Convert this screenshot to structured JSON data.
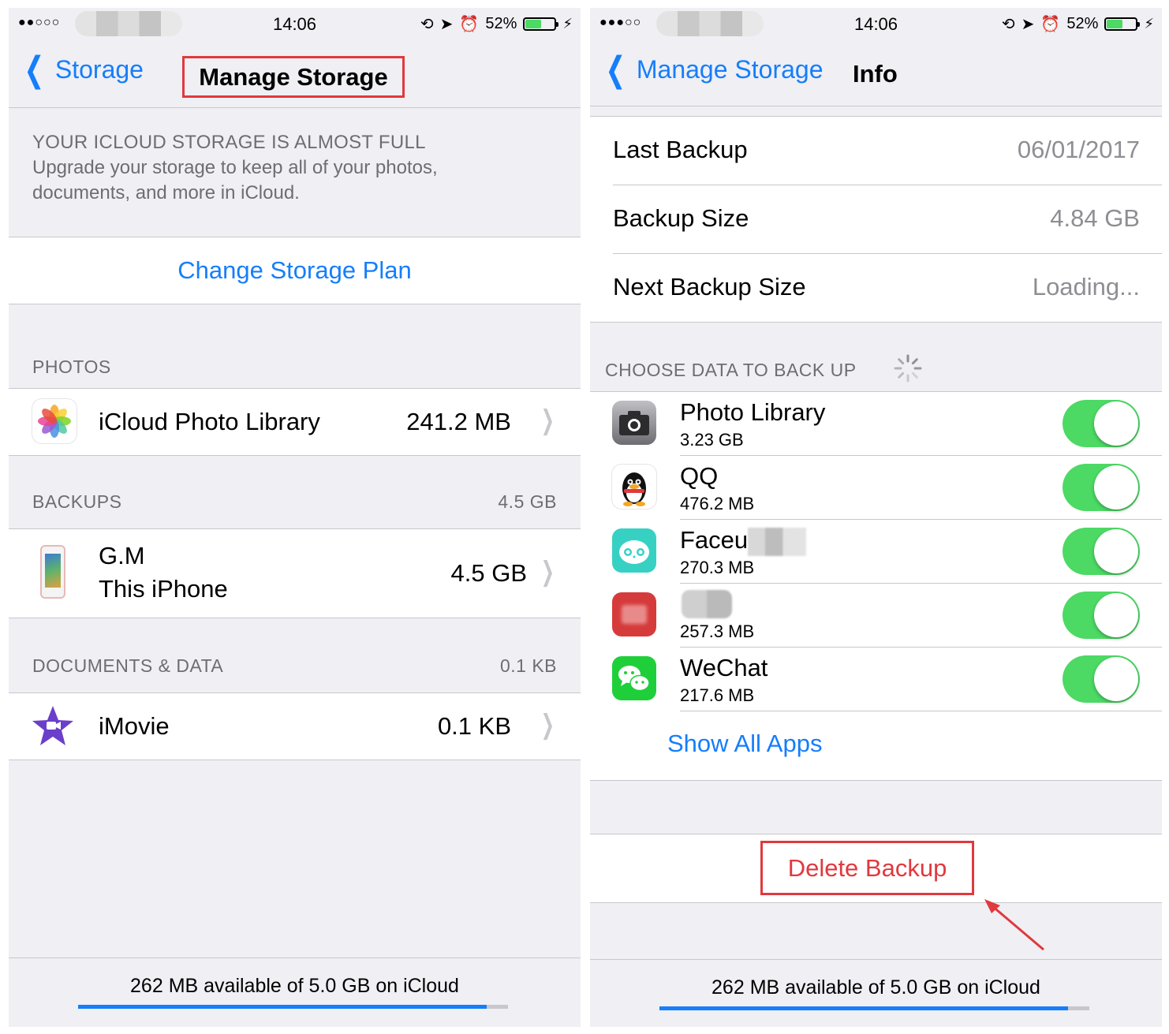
{
  "left": {
    "status": {
      "signal": "●●○○○",
      "time": "14:06",
      "battery": "52%",
      "battery_level": 0.52
    },
    "nav": {
      "back_label": "Storage",
      "title": "Manage Storage"
    },
    "warning": {
      "heading": "YOUR ICLOUD STORAGE IS ALMOST FULL",
      "line1": "Upgrade your storage to keep all of your photos,",
      "line2": "documents, and more in iCloud."
    },
    "change_plan": "Change Storage Plan",
    "photos": {
      "header": "PHOTOS",
      "item": {
        "name": "iCloud Photo Library",
        "size": "241.2 MB",
        "icon": "photos-icon"
      }
    },
    "backups": {
      "header": "BACKUPS",
      "total": "4.5 GB",
      "item": {
        "name": "G.M",
        "subtitle": "This iPhone",
        "size": "4.5 GB",
        "icon": "iphone-icon"
      }
    },
    "documents": {
      "header": "DOCUMENTS & DATA",
      "total": "0.1 KB",
      "item": {
        "name": "iMovie",
        "size": "0.1 KB",
        "icon": "imovie-icon"
      }
    },
    "footer": {
      "text": "262 MB available of 5.0 GB on iCloud",
      "used_fraction": 0.95
    }
  },
  "right": {
    "status": {
      "signal": "●●●○○",
      "time": "14:06",
      "battery": "52%",
      "battery_level": 0.52
    },
    "nav": {
      "back_label": "Manage Storage",
      "title": "Info"
    },
    "info": [
      {
        "label": "Last Backup",
        "value": "06/01/2017"
      },
      {
        "label": "Backup Size",
        "value": "4.84 GB"
      },
      {
        "label": "Next Backup Size",
        "value": "Loading..."
      }
    ],
    "choose_header": "CHOOSE DATA TO BACK UP",
    "apps": [
      {
        "name": "Photo Library",
        "size": "3.23 GB",
        "icon": "camera-icon",
        "on": true
      },
      {
        "name": "QQ",
        "size": "476.2 MB",
        "icon": "qq-penguin-icon",
        "on": true
      },
      {
        "name": "Faceu",
        "size": "270.3 MB",
        "icon": "faceu-icon",
        "on": true
      },
      {
        "name": "",
        "size": "257.3 MB",
        "icon": "red-app-icon",
        "on": true
      },
      {
        "name": "WeChat",
        "size": "217.6 MB",
        "icon": "wechat-icon",
        "on": true
      }
    ],
    "show_all": "Show All Apps",
    "delete_backup": "Delete Backup",
    "footer": {
      "text": "262 MB available of 5.0 GB on iCloud",
      "used_fraction": 0.95
    }
  },
  "colors": {
    "accent": "#157efb",
    "destructive": "#e0393e",
    "toggle_on": "#4cd964"
  }
}
